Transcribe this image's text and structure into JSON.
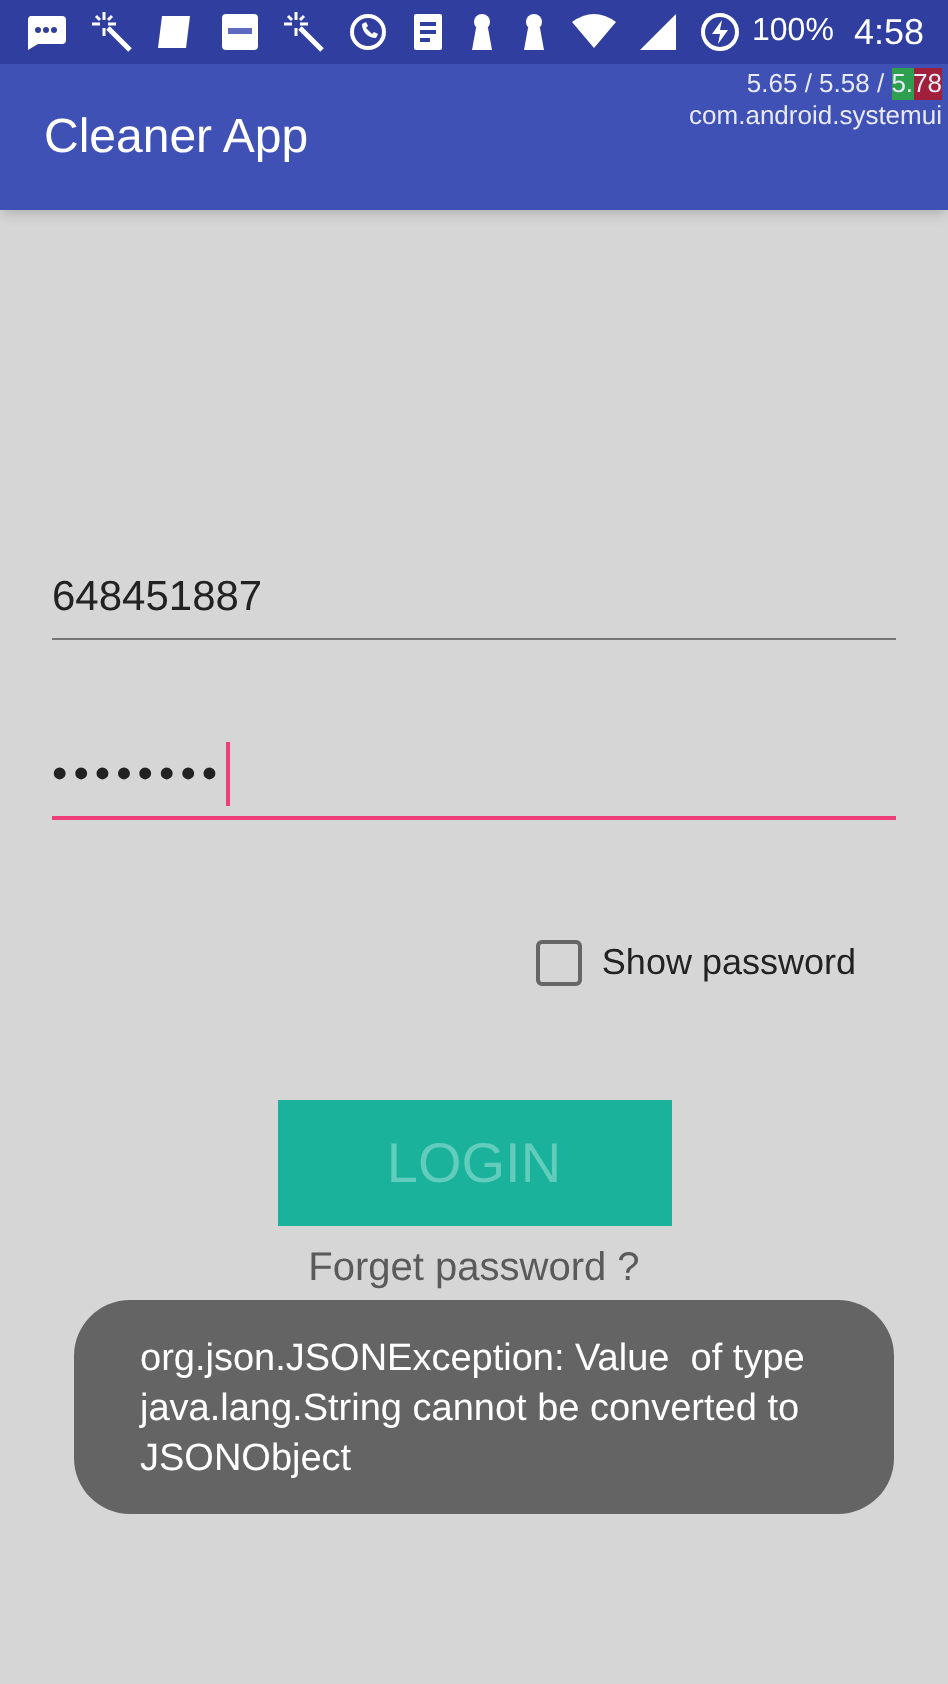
{
  "status_bar": {
    "battery": "100%",
    "time": "4:58"
  },
  "debug_overlay": {
    "readings": [
      "5.65 / 5.58 / ",
      "5.",
      "78"
    ],
    "process": "com.android.systemui"
  },
  "app_bar": {
    "title": "Cleaner App"
  },
  "form": {
    "fields": [
      {
        "kind": "text",
        "value": "648451887",
        "focused": false
      },
      {
        "kind": "password",
        "value": "••••••••",
        "focused": true
      }
    ],
    "show_password": {
      "label": "Show password",
      "checked": false
    },
    "login_button": {
      "label": "LOGIN",
      "disabled": true
    },
    "forgot_link": "Forget password ?"
  },
  "toast": {
    "message": "org.json.JSONException: Value  of type java.lang.String cannot be converted to JSONObject"
  }
}
